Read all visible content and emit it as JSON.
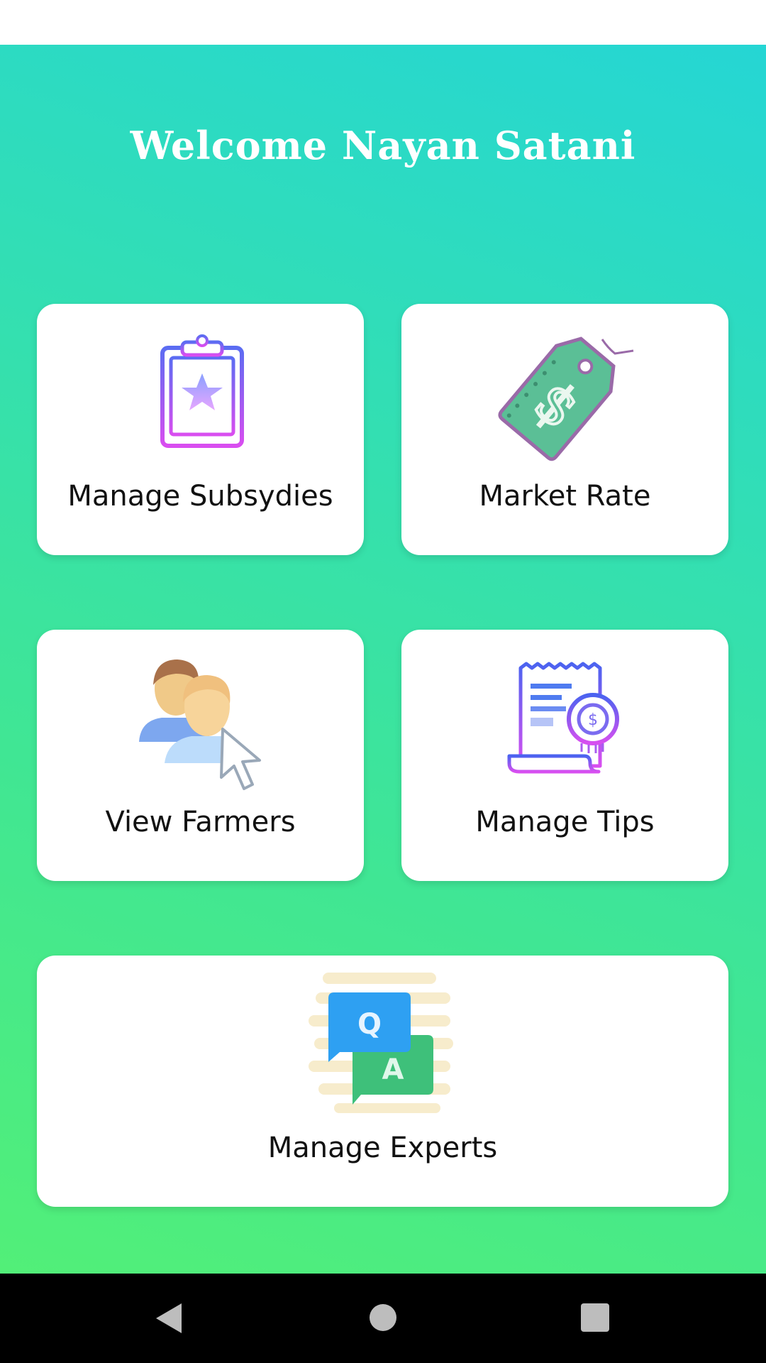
{
  "header": {
    "welcome": "Welcome Nayan Satani"
  },
  "cards": {
    "subsidies": {
      "label": "Manage Subsydies",
      "icon": "clipboard-star-icon"
    },
    "market_rate": {
      "label": "Market Rate",
      "icon": "price-tag-icon"
    },
    "farmers": {
      "label": "View Farmers",
      "icon": "users-cursor-icon"
    },
    "tips": {
      "label": "Manage Tips",
      "icon": "receipt-coin-icon"
    },
    "experts": {
      "label": "Manage Experts",
      "icon": "qa-chat-icon"
    }
  },
  "colors": {
    "gradient_top": "#25d6d4",
    "gradient_bottom": "#52ef78",
    "card": "#ffffff"
  },
  "navigation": {
    "back": "back-icon",
    "home": "home-icon",
    "recents": "recents-icon"
  }
}
